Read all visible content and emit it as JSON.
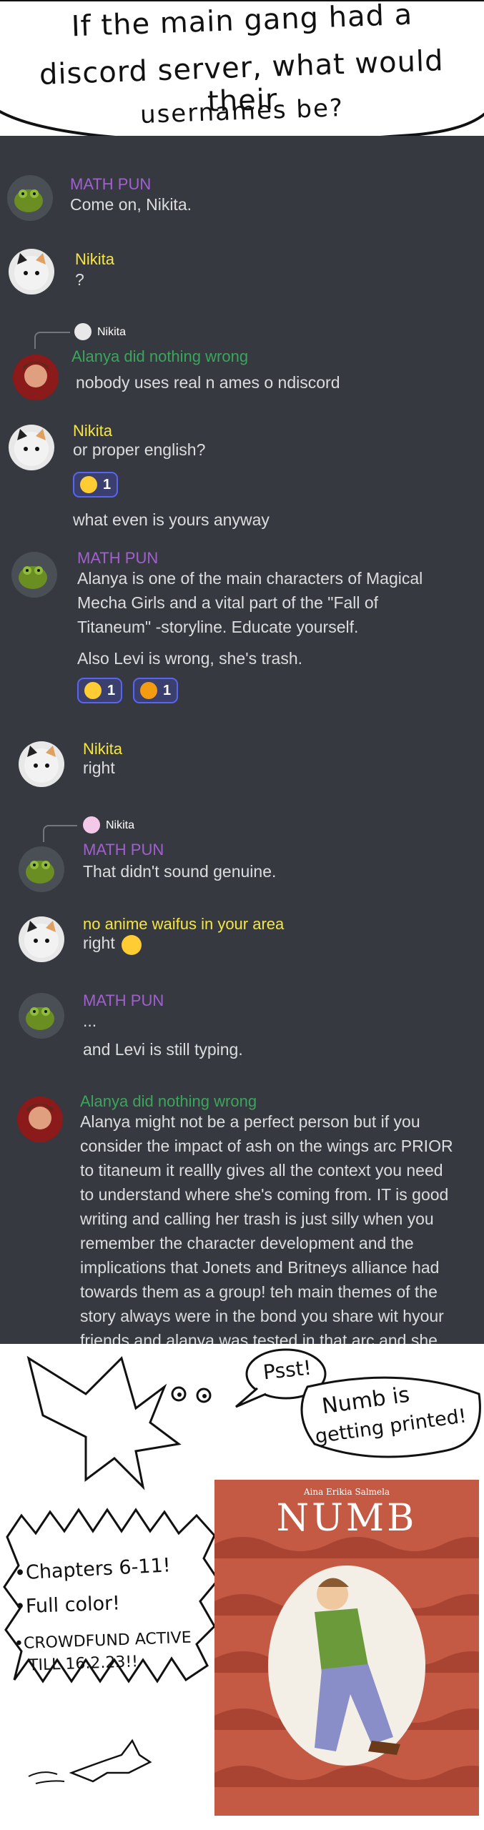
{
  "header": {
    "line1": "If the main gang had a",
    "line2": "discord server, what would their",
    "line3": "usernames be?"
  },
  "messages": [
    {
      "user": "MATH PUN",
      "lines": [
        "Come on, Nikita."
      ]
    },
    {
      "user": "Nikita",
      "lines": [
        "?"
      ]
    },
    {
      "reply_to": "Nikita",
      "user": "Alanya did nothing wrong",
      "lines": [
        "nobody uses real n ames o ndiscord"
      ]
    },
    {
      "user": "Nikita",
      "lines": [
        "or proper english?"
      ],
      "reactions": [
        {
          "emoji": "sob-emoji",
          "count": "1"
        }
      ],
      "followup": "what even is yours anyway"
    },
    {
      "user": "MATH PUN",
      "lines": [
        "Alanya is one of the main characters of Magical",
        "Mecha Girls and a vital part of the \"Fall of",
        "Titaneum\" -storyline. Educate yourself."
      ],
      "followup": "Also Levi is wrong, she's trash.",
      "reactions": [
        {
          "emoji": "shocked-emoji",
          "count": "1"
        },
        {
          "emoji": "angry-emoji",
          "count": "1"
        }
      ]
    },
    {
      "user": "Nikita",
      "lines": [
        "right"
      ]
    },
    {
      "reply_to": "Nikita",
      "user": "MATH PUN",
      "lines": [
        "That didn't sound genuine."
      ]
    },
    {
      "user": "no anime waifus in your area",
      "lines": [
        "right"
      ]
    },
    {
      "user": "MATH PUN",
      "lines": [
        "..."
      ],
      "followup": "and Levi is still typing."
    },
    {
      "user": "Alanya did nothing wrong",
      "lines": [
        "Alanya might not be a perfect person but if you",
        "consider the impact of ash on the wings arc PRIOR",
        "to titaneum it reallly gives  all the context you need",
        "to understand where she's coming from. IT is good",
        "writing  and calling her trash is just silly when you",
        "remember the character development and the",
        "implications that Jonets and Britneys alliance had",
        "towards them as a group! teh main themes of the",
        "story always were in the bond you share wit hyour",
        "friends and alanya was tested in that arc and she"
      ]
    }
  ],
  "ad": {
    "psst": "Psst!",
    "numb_line1": "Numb is",
    "numb_line2": "getting printed!",
    "bullet1": "•Chapters 6-11!",
    "bullet2": "•Full color!",
    "bullet3a": "•CROWDFUND ACTIVE",
    "bullet3b": "TILL 16.2.23!!",
    "book_title": "NUMB",
    "book_author": "Aina Erikia Salmela"
  },
  "colors": {
    "discord_bg": "#36393f",
    "math_pun": "#a160d0",
    "nikita": "#f5e642",
    "alanya": "#3ba55c",
    "text": "#dcddde"
  }
}
